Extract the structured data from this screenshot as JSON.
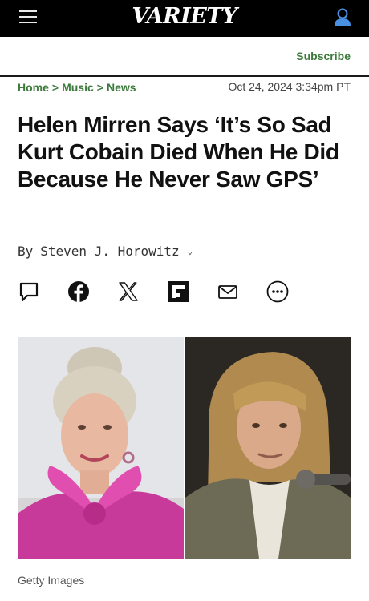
{
  "header": {
    "logo_text": "VARIETY",
    "menu_icon": "hamburger-menu-icon",
    "account_icon": "user-account-icon"
  },
  "subscribe_label": "Subscribe",
  "breadcrumb": {
    "items": [
      "Home",
      "Music",
      "News"
    ],
    "separator": ">"
  },
  "dateline": "Oct 24, 2024 3:34pm PT",
  "article": {
    "headline": "Helen Mirren Says ‘It’s So Sad Kurt Cobain Died When He Did Because He Never Saw GPS’",
    "byline_prefix": "By",
    "author": "Steven J. Horowitz"
  },
  "share_icons": [
    "comment-icon",
    "facebook-icon",
    "x-twitter-icon",
    "flipboard-icon",
    "email-icon",
    "more-options-icon"
  ],
  "image_credit": "Getty Images",
  "colors": {
    "topbar": "#000000",
    "accent_green": "#3b7a3b",
    "account_blue": "#4a90e2"
  }
}
